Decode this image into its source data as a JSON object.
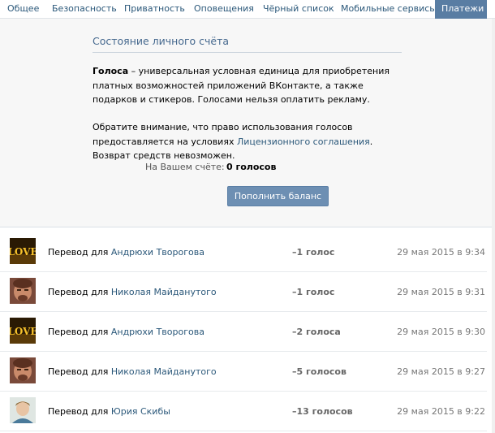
{
  "tabs": [
    {
      "label": "Общее"
    },
    {
      "label": "Безопасность"
    },
    {
      "label": "Приватность"
    },
    {
      "label": "Оповещения"
    },
    {
      "label": "Чёрный список"
    },
    {
      "label": "Мобильные сервисы"
    },
    {
      "label": "Платежи",
      "active": true
    }
  ],
  "account": {
    "title": "Состояние личного счёта",
    "intro_bold": "Голоса",
    "intro_rest": " – универсальная условная единица для приобретения платных возможностей приложений ВКонтакте, а также подарков и стикеров. Голосами нельзя оплатить рекламу.",
    "notice_before": "Обратите внимание, что право использования голосов предоставляется на условиях ",
    "notice_link": "Лицензионного соглашения",
    "notice_after": ". Возврат средств невозможен.",
    "balance_label": "На Вашем счёте:",
    "balance_value": "0 голосов",
    "topup_button": "Пополнить баланс"
  },
  "transactions": [
    {
      "prefix": "Перевод для ",
      "name": "Андрюхи Творогова",
      "amount": "–1 голос",
      "date": "29 мая 2015 в 9:34",
      "avatar": "love"
    },
    {
      "prefix": "Перевод для ",
      "name": "Николая Майданутого",
      "amount": "–1 голос",
      "date": "29 мая 2015 в 9:31",
      "avatar": "face"
    },
    {
      "prefix": "Перевод для ",
      "name": "Андрюхи Творогова",
      "amount": "–2 голоса",
      "date": "29 мая 2015 в 9:30",
      "avatar": "love"
    },
    {
      "prefix": "Перевод для ",
      "name": "Николая Майданутого",
      "amount": "–5 голосов",
      "date": "29 мая 2015 в 9:27",
      "avatar": "face"
    },
    {
      "prefix": "Перевод для ",
      "name": "Юрия Скибы",
      "amount": "–13 голосов",
      "date": "29 мая 2015 в 9:22",
      "avatar": "person"
    }
  ],
  "colors": {
    "tab_active_bg": "#597da3",
    "link": "#2b587a",
    "button_bg": "#6d8fb3",
    "title": "#45688e"
  }
}
